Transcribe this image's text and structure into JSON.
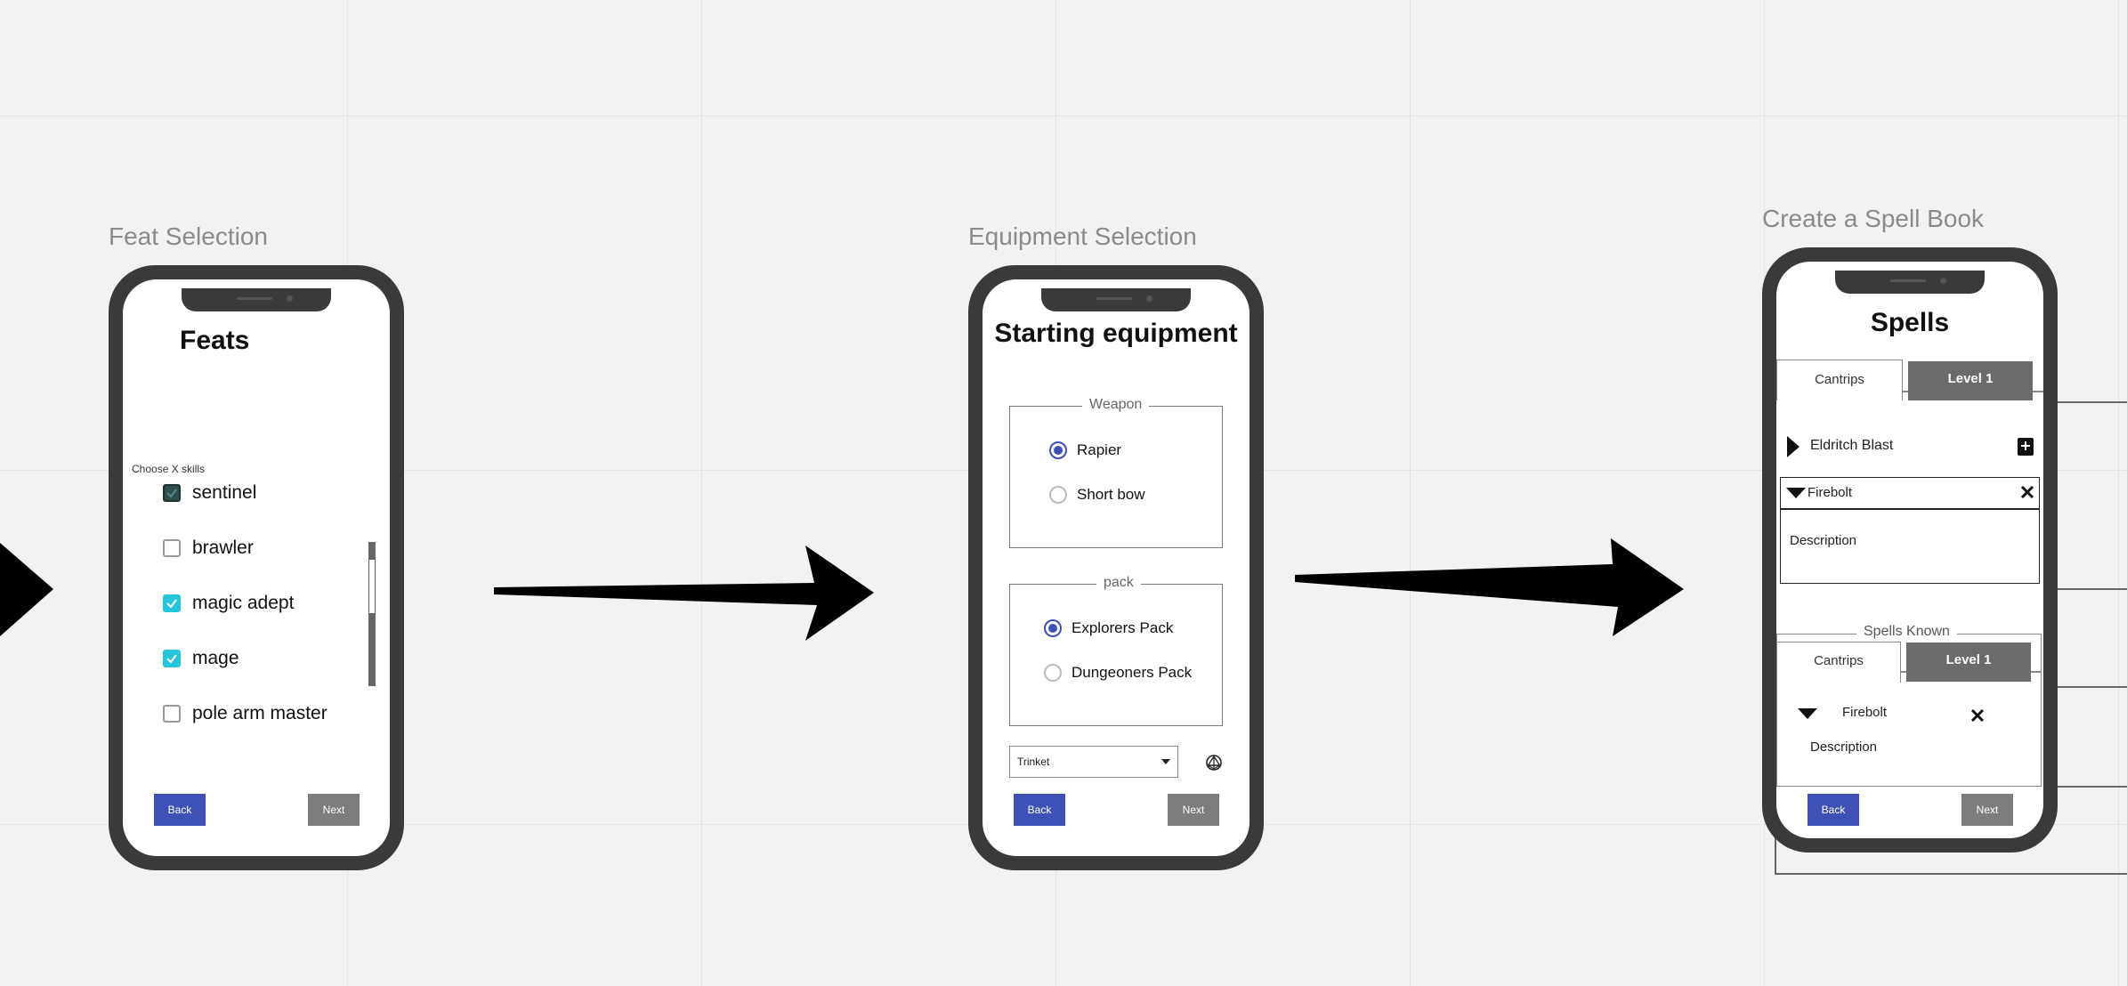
{
  "titles": {
    "feat": "Feat Selection",
    "equipment": "Equipment Selection",
    "spellbook": "Create a Spell Book"
  },
  "feat_screen": {
    "heading": "Feats",
    "instruction": "Choose X skills",
    "options": [
      {
        "label": "sentinel",
        "checked": true
      },
      {
        "label": "brawler",
        "checked": false
      },
      {
        "label": "magic adept",
        "checked": true
      },
      {
        "label": "mage",
        "checked": true
      },
      {
        "label": "pole arm master",
        "checked": false
      }
    ],
    "scroll_position": 0.2,
    "back_label": "Back",
    "next_label": "Next"
  },
  "equipment_screen": {
    "heading": "Starting equipment",
    "weapon_group": {
      "legend": "Weapon",
      "options": [
        {
          "label": "Rapier",
          "selected": true
        },
        {
          "label": "Short bow",
          "selected": false
        }
      ]
    },
    "pack_group": {
      "legend": "pack",
      "options": [
        {
          "label": "Explorers Pack",
          "selected": true
        },
        {
          "label": "Dungeoners Pack",
          "selected": false
        }
      ]
    },
    "trinket_select": {
      "value": "Trinket"
    },
    "back_label": "Back",
    "next_label": "Next"
  },
  "spell_screen": {
    "heading": "Spells",
    "tabs": [
      {
        "label": "Cantrips",
        "active": true
      },
      {
        "label": "Level 1",
        "active": false
      }
    ],
    "spell_list": [
      {
        "name": "Eldritch Blast",
        "expanded": false
      },
      {
        "name": "Firebolt",
        "expanded": true,
        "description": "Description"
      }
    ],
    "known_section": {
      "legend": "Spells Known",
      "tabs": [
        {
          "label": "Cantrips",
          "active": true
        },
        {
          "label": "Level 1",
          "active": false
        }
      ],
      "spell": {
        "name": "Firebolt",
        "description": "Description"
      }
    },
    "back_label": "Back",
    "next_label": "Next"
  },
  "colors": {
    "primary": "#3f51b5",
    "secondary": "#7d7d7d",
    "checked": "#26c6da",
    "phone": "#3a3a3a",
    "tab_inactive": "#6b6b6b"
  }
}
